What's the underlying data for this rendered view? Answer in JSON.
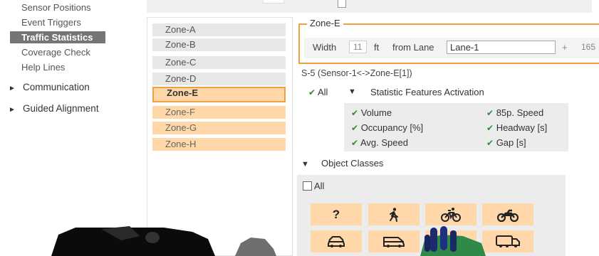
{
  "nav": {
    "items": [
      {
        "label": "Sensor Positions",
        "active": false
      },
      {
        "label": "Event Triggers",
        "active": false
      },
      {
        "label": "Traffic Statistics",
        "active": true
      },
      {
        "label": "Coverage Check",
        "active": false
      },
      {
        "label": "Help Lines",
        "active": false
      }
    ],
    "groups": [
      {
        "label": "Communication",
        "caret": "►"
      },
      {
        "label": "Guided Alignment",
        "caret": "►"
      }
    ]
  },
  "zones": [
    {
      "label": "Zone-A",
      "state": "normal"
    },
    {
      "label": "Zone-B",
      "state": "normal"
    },
    {
      "label": "Zone-C",
      "state": "normal"
    },
    {
      "label": "Zone-D",
      "state": "normal"
    },
    {
      "label": "Zone-E",
      "state": "selected"
    },
    {
      "label": "Zone-F",
      "state": "warm"
    },
    {
      "label": "Zone-G",
      "state": "warm"
    },
    {
      "label": "Zone-H",
      "state": "warm"
    }
  ],
  "zone_panel": {
    "title": "Zone-E",
    "width_label": "Width",
    "width_value": "11",
    "unit": "ft",
    "from_lane_label": "from Lane",
    "lane_value": "Lane-1",
    "plus": "+",
    "offset_value": "165"
  },
  "sensor_line": "S-5 (Sensor-1<->Zone-E[1])",
  "stats": {
    "all_label": "All",
    "caret": "▼",
    "header": "Statistic Features Activation",
    "features": [
      {
        "label": "Volume",
        "checked": true
      },
      {
        "label": "85p. Speed",
        "checked": true
      },
      {
        "label": "Occupancy [%]",
        "checked": true
      },
      {
        "label": "Headway [s]",
        "checked": true
      },
      {
        "label": "Avg. Speed",
        "checked": true
      },
      {
        "label": "Gap [s]",
        "checked": true
      }
    ]
  },
  "object_classes": {
    "caret": "▼",
    "header": "Object Classes",
    "all_label": "All",
    "tiles": [
      {
        "icon": "unknown-icon",
        "label": "?"
      },
      {
        "icon": "pedestrian-icon",
        "label": "✸"
      },
      {
        "icon": "bicycle-icon",
        "label": ""
      },
      {
        "icon": "motorcycle-icon",
        "label": ""
      },
      {
        "icon": "car-icon",
        "label": ""
      },
      {
        "icon": "van-icon",
        "label": ""
      },
      {
        "icon": "truck-icon",
        "label": ""
      },
      {
        "icon": "bus-truck-icon",
        "label": ""
      }
    ]
  },
  "colors": {
    "accent_orange": "#f0a040",
    "zone_warm": "#ffd7a8",
    "check_green": "#2e8b30",
    "nav_active_bg": "#757575"
  }
}
